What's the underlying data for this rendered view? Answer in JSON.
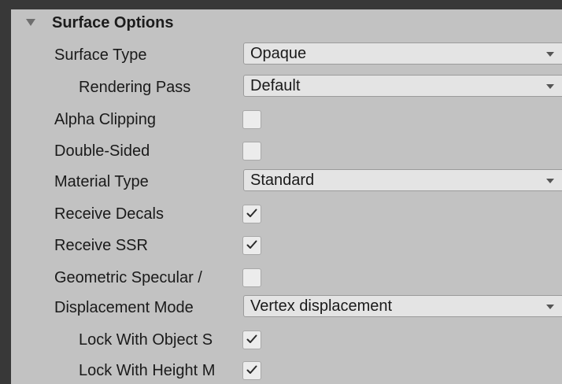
{
  "section": {
    "title": "Surface Options",
    "expanded": true,
    "arrow_icon": "triangle-down-icon"
  },
  "fields": {
    "surface_type": {
      "label": "Surface Type",
      "value": "Opaque"
    },
    "rendering_pass": {
      "label": "Rendering Pass",
      "value": "Default"
    },
    "alpha_clipping": {
      "label": "Alpha Clipping",
      "checked": false
    },
    "double_sided": {
      "label": "Double-Sided",
      "checked": false
    },
    "material_type": {
      "label": "Material Type",
      "value": "Standard"
    },
    "receive_decals": {
      "label": "Receive Decals",
      "checked": true
    },
    "receive_ssr": {
      "label": "Receive SSR",
      "checked": true
    },
    "geometric_specular_aa": {
      "label": "Geometric Specular /",
      "checked": false
    },
    "displacement_mode": {
      "label": "Displacement Mode",
      "value": "Vertex displacement"
    },
    "lock_with_object_scale": {
      "label": "Lock With Object S",
      "checked": true
    },
    "lock_with_height_map": {
      "label": "Lock With Height M",
      "checked": true
    }
  },
  "colors": {
    "background": "#383838",
    "panel": "#c2c2c2",
    "dropdown": "#e4e4e4",
    "checkbox": "#ececec",
    "text": "#1a1a1a"
  },
  "icons": {
    "dropdown_arrow": "chevron-down-icon",
    "check": "checkmark-icon"
  }
}
